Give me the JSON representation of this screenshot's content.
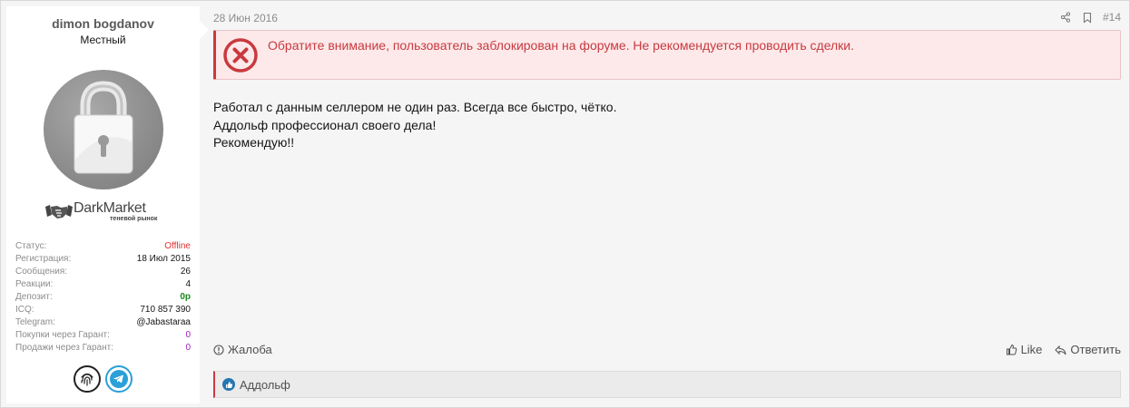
{
  "user": {
    "name": "dimon bogdanov",
    "title": "Местный",
    "logo_text": "DarkMarket",
    "logo_sub": "теневой рынок",
    "stats": [
      {
        "label": "Статус:",
        "value": "Offline",
        "style": "red"
      },
      {
        "label": "Регистрация:",
        "value": "18 Июл 2015",
        "style": ""
      },
      {
        "label": "Сообщения:",
        "value": "26",
        "style": ""
      },
      {
        "label": "Реакции:",
        "value": "4",
        "style": ""
      },
      {
        "label": "Депозит:",
        "value": "0р",
        "style": "green"
      },
      {
        "label": "ICQ:",
        "value": "710 857 390",
        "style": ""
      },
      {
        "label": "Telegram:",
        "value": "@Jabastaraa",
        "style": ""
      },
      {
        "label": "Покупки через Гарант:",
        "value": "0",
        "style": "purple"
      },
      {
        "label": "Продажи через Гарант:",
        "value": "0",
        "style": "purple"
      }
    ]
  },
  "post": {
    "date": "28 Июн 2016",
    "number": "#14",
    "warning": "Обратите внимание, пользователь заблокирован на форуме. Не рекомендуется проводить сделки.",
    "lines": [
      "Работал с данным селлером не один раз. Всегда все быстро, чётко.",
      "Аддольф профессионал своего дела!",
      "Рекомендую!!"
    ]
  },
  "footer": {
    "report_label": "Жалоба",
    "like_label": "Like",
    "reply_label": "Ответить"
  },
  "likes": {
    "users": "Аддольф"
  },
  "colors": {
    "warning_accent": "#c83a3f",
    "telegram": "#2a9fd8",
    "like_blue": "#2577b1"
  }
}
